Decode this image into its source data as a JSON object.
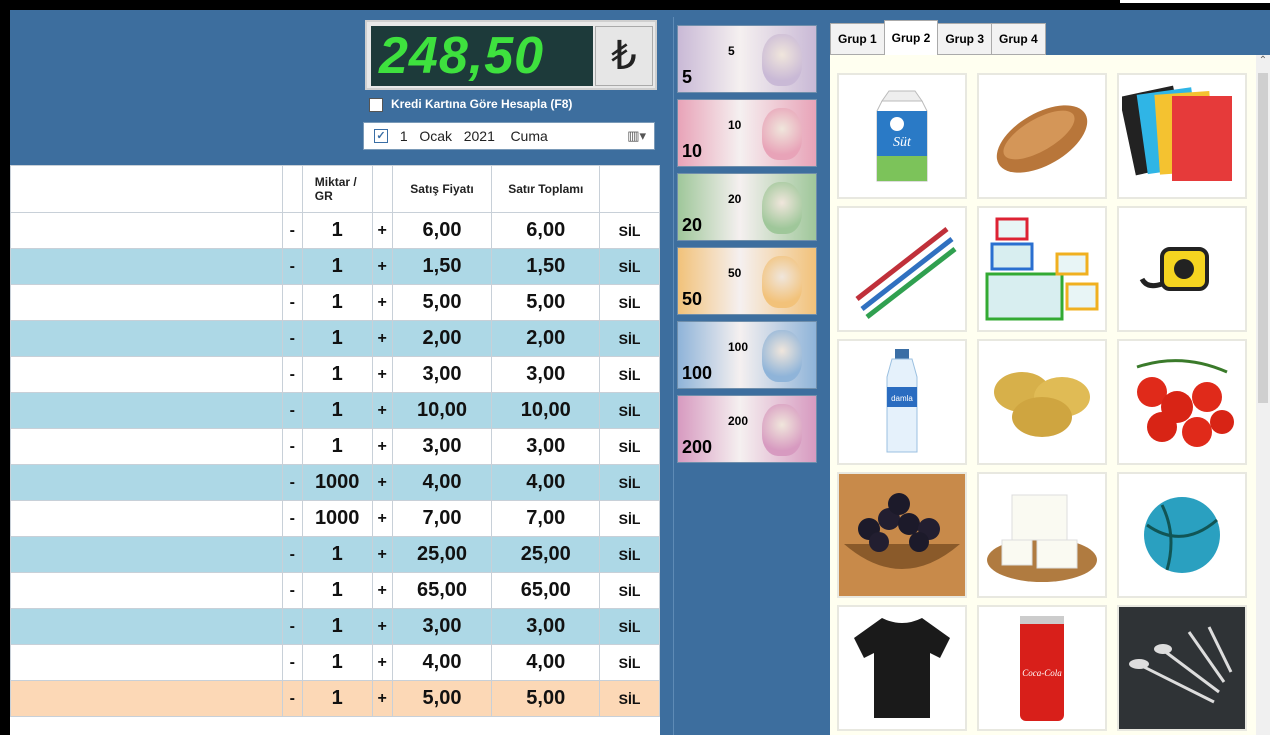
{
  "total": {
    "amount": "248,50",
    "currency_symbol": "₺"
  },
  "credit_option": {
    "label": "Kredi Kartına Göre Hesapla (F8)",
    "checked": false
  },
  "date": {
    "checked": true,
    "day": "1",
    "month": "Ocak",
    "year": "2021",
    "weekday": "Cuma"
  },
  "table": {
    "headers": {
      "miktar": "Miktar / GR",
      "satis": "Satış Fiyatı",
      "toplam": "Satır Toplamı"
    },
    "minus": "-",
    "plus": "+",
    "delete_label": "SİL",
    "rows": [
      {
        "qty": "1",
        "price": "6,00",
        "total": "6,00"
      },
      {
        "qty": "1",
        "price": "1,50",
        "total": "1,50"
      },
      {
        "qty": "1",
        "price": "5,00",
        "total": "5,00"
      },
      {
        "qty": "1",
        "price": "2,00",
        "total": "2,00"
      },
      {
        "qty": "1",
        "price": "3,00",
        "total": "3,00"
      },
      {
        "qty": "1",
        "price": "10,00",
        "total": "10,00"
      },
      {
        "qty": "1",
        "price": "3,00",
        "total": "3,00"
      },
      {
        "qty": "1000",
        "price": "4,00",
        "total": "4,00"
      },
      {
        "qty": "1000",
        "price": "7,00",
        "total": "7,00"
      },
      {
        "qty": "1",
        "price": "25,00",
        "total": "25,00"
      },
      {
        "qty": "1",
        "price": "65,00",
        "total": "65,00"
      },
      {
        "qty": "1",
        "price": "3,00",
        "total": "3,00"
      },
      {
        "qty": "1",
        "price": "4,00",
        "total": "4,00"
      },
      {
        "qty": "1",
        "price": "5,00",
        "total": "5,00"
      }
    ]
  },
  "banknotes": [
    {
      "value": "5",
      "color": "#c9b9d6"
    },
    {
      "value": "10",
      "color": "#e8a3b8"
    },
    {
      "value": "20",
      "color": "#9fc79a"
    },
    {
      "value": "50",
      "color": "#f2c27a"
    },
    {
      "value": "100",
      "color": "#8fb4d9"
    },
    {
      "value": "200",
      "color": "#d79ac0"
    }
  ],
  "tabs": [
    "Grup 1",
    "Grup 2",
    "Grup 3",
    "Grup 4"
  ],
  "active_tab": "Grup 2",
  "products": [
    {
      "name": "süt",
      "icon": "milk-carton-icon",
      "label": "Süt"
    },
    {
      "name": "ekmek",
      "icon": "bread-icon"
    },
    {
      "name": "defter",
      "icon": "notebook-icon"
    },
    {
      "name": "kalem",
      "icon": "pencil-icon"
    },
    {
      "name": "saklama kabı",
      "icon": "container-icon"
    },
    {
      "name": "metre",
      "icon": "tape-measure-icon"
    },
    {
      "name": "su",
      "icon": "water-bottle-icon",
      "label": "damla"
    },
    {
      "name": "patates",
      "icon": "potato-icon"
    },
    {
      "name": "domates",
      "icon": "tomato-icon"
    },
    {
      "name": "zeytin",
      "icon": "olives-icon"
    },
    {
      "name": "peynir",
      "icon": "cheese-icon"
    },
    {
      "name": "top",
      "icon": "ball-icon"
    },
    {
      "name": "tişört",
      "icon": "tshirt-icon"
    },
    {
      "name": "kola",
      "icon": "cola-can-icon",
      "label": "Coca-Cola"
    },
    {
      "name": "çatal kaşık",
      "icon": "cutlery-icon"
    }
  ]
}
